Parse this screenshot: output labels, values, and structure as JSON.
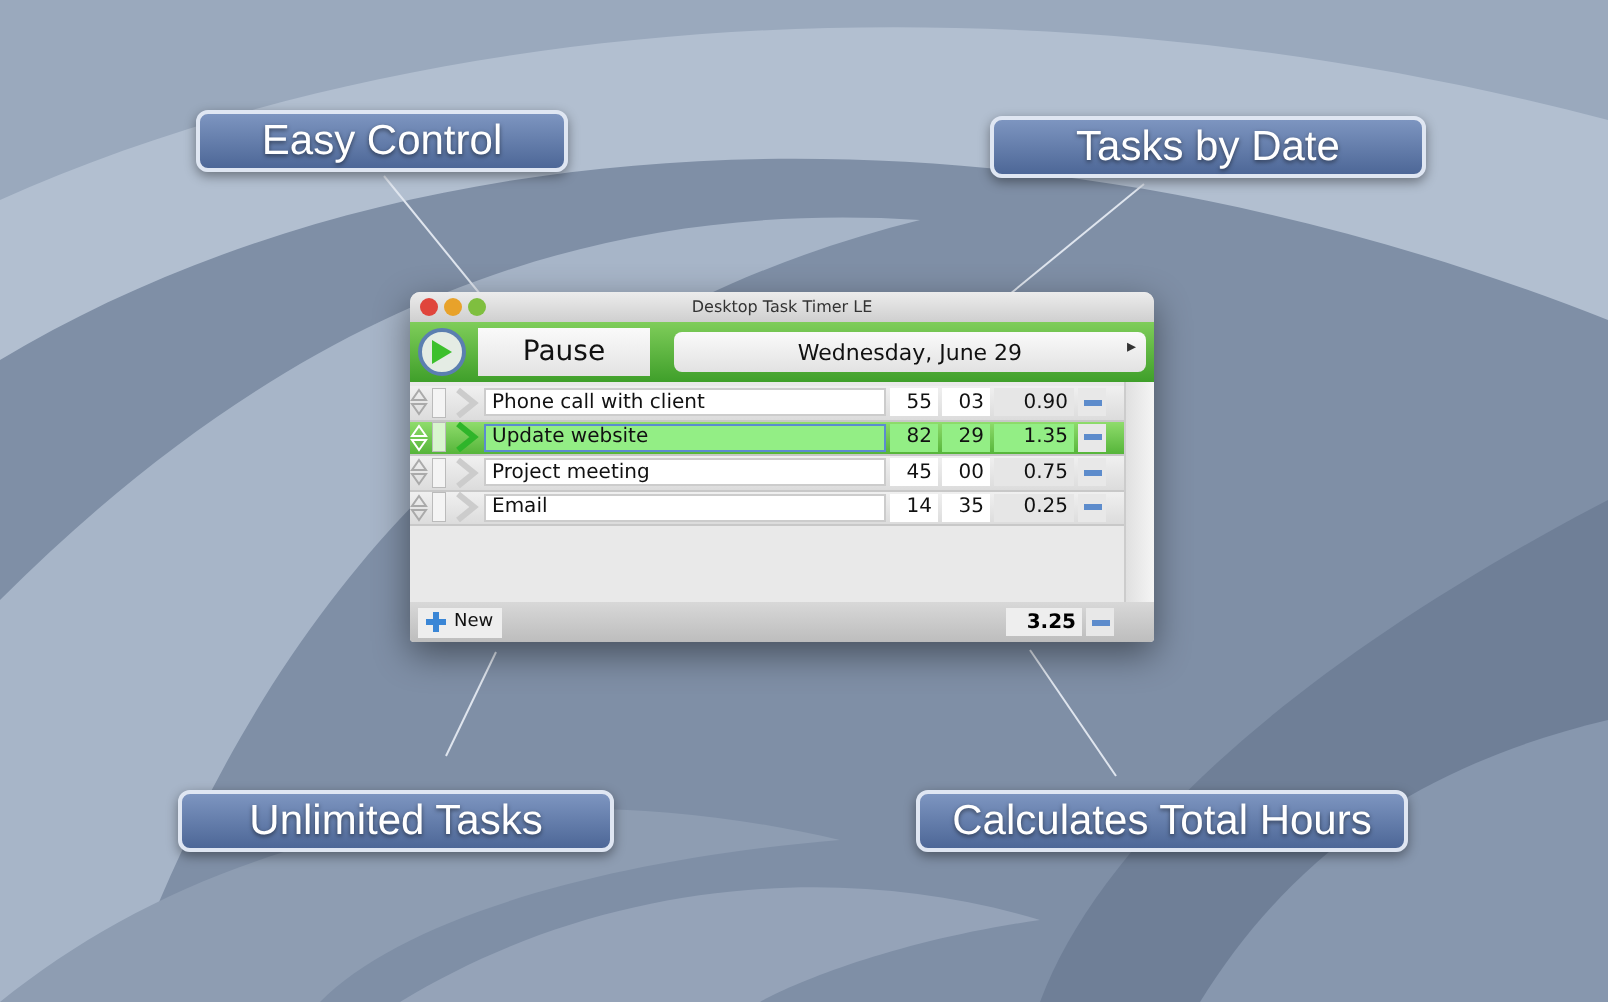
{
  "callouts": [
    {
      "text": "Easy Control"
    },
    {
      "text": "Tasks by Date"
    },
    {
      "text": "Unlimited Tasks"
    },
    {
      "text": "Calculates Total Hours"
    }
  ],
  "window": {
    "title": "Desktop Task Timer LE"
  },
  "toolbar": {
    "running": true,
    "pause_button": "Pause",
    "date": "Wednesday, June 29",
    "next_arrow": "▸"
  },
  "tasks": [
    {
      "name": "Phone call with client",
      "minutes": "55",
      "seconds": "03",
      "hours": "0.90",
      "selected": false
    },
    {
      "name": "Update website",
      "minutes": "82",
      "seconds": "29",
      "hours": "1.35",
      "selected": true
    },
    {
      "name": "Project meeting",
      "minutes": "45",
      "seconds": "00",
      "hours": "0.75",
      "selected": false
    },
    {
      "name": "Email",
      "minutes": "14",
      "seconds": "35",
      "hours": "0.25",
      "selected": false
    }
  ],
  "footer": {
    "new_button": "New",
    "total": "3.25"
  }
}
